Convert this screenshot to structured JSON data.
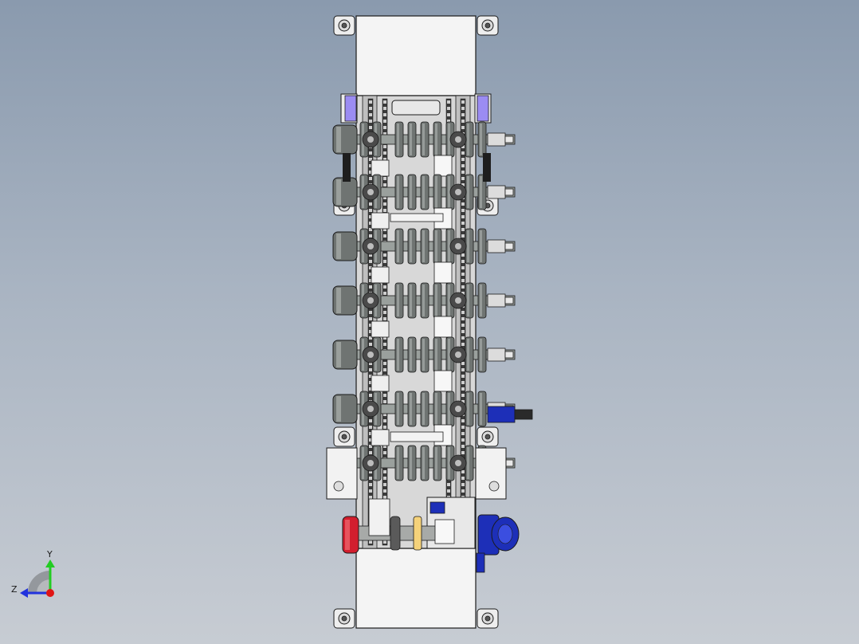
{
  "viewport": {
    "background_top": "#8a9aae",
    "background_bottom": "#c7ccd3"
  },
  "model": {
    "description_hidden": "",
    "roller_rows": 7,
    "part_colors": {
      "frame": "#f4f4f4",
      "roller": "#6f7472",
      "roller_highlight": "#b7bcb9",
      "chain": "#3a3a3a",
      "bracket": "#9b8cf2",
      "motor_blue": "#1d2fb8",
      "motor_red": "#d21e2e",
      "outline": "#1b1b1b"
    }
  },
  "triad": {
    "x_label": "",
    "y_label": "Y",
    "z_label": "Z",
    "y_color": "#22cc22",
    "z_color": "#2233dd",
    "origin_color": "#e01515"
  }
}
